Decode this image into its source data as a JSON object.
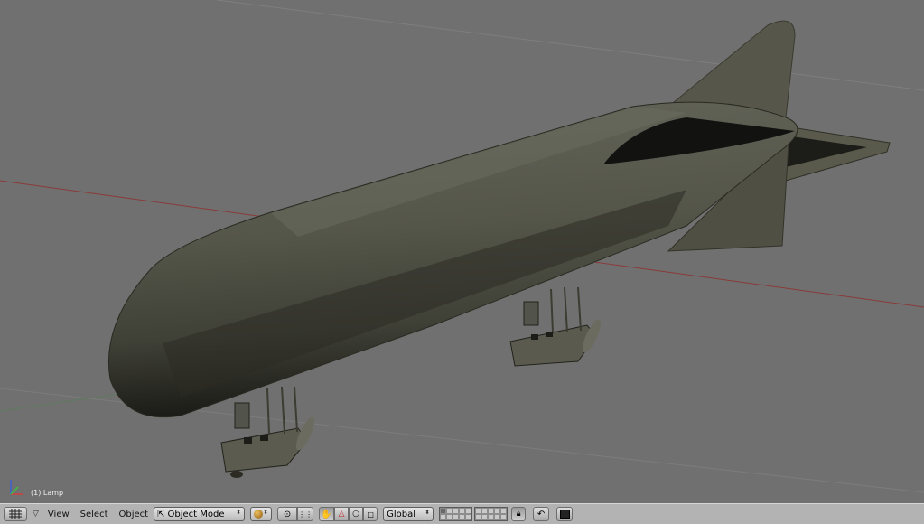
{
  "viewport": {
    "object_label": "(1) Lamp",
    "background": "#707070"
  },
  "header": {
    "menus": {
      "view": "View",
      "select": "Select",
      "object": "Object"
    },
    "mode": {
      "label": "Object Mode"
    },
    "orientation": {
      "label": "Global"
    },
    "icons": {
      "window_type": "grid-icon",
      "expand": "triangle-down-icon",
      "mode": "object-mode-icon",
      "draw_type": "shading-sphere-icon",
      "pivot": "pivot-icon",
      "snap": "snap-icon",
      "manipulator_hand": "hand-icon",
      "manipulator_translate": "translate-icon",
      "manipulator_rotate": "rotate-icon",
      "manipulator_scale": "scale-icon",
      "lock": "lock-icon",
      "undo": "undo-icon",
      "render": "render-icon"
    }
  }
}
